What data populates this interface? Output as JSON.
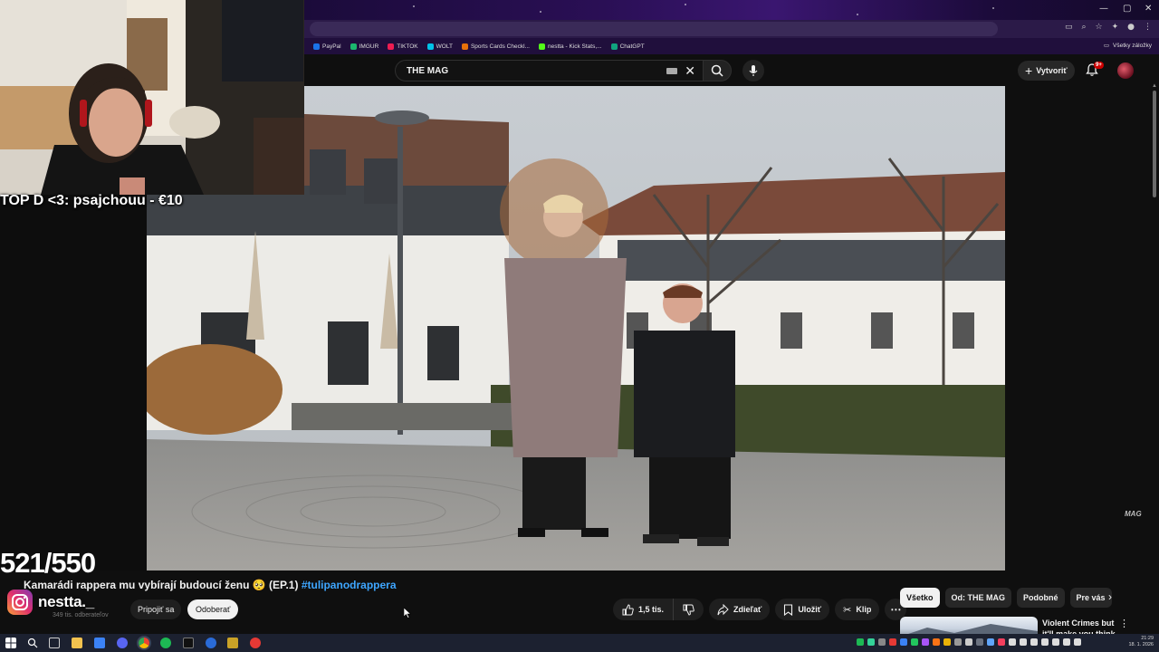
{
  "stream_overlay": {
    "donation_text": "TOP D <3: psajchouu - €10",
    "counter": "521/550",
    "instagram_handle": "nestta._"
  },
  "browser": {
    "bookmarks": [
      {
        "label": "PayPal",
        "color": "#1a73e8"
      },
      {
        "label": "IMGUR",
        "color": "#1bb76e"
      },
      {
        "label": "TIKTOK",
        "color": "#ee1d52"
      },
      {
        "label": "WOLT",
        "color": "#00c2e8"
      },
      {
        "label": "Sports Cards Checkl...",
        "color": "#e8710a"
      },
      {
        "label": "nestta - Kick Stats,...",
        "color": "#53fc18"
      },
      {
        "label": "ChatGPT",
        "color": "#10a37f"
      }
    ],
    "bookmarks_right": "Všetky záložky"
  },
  "youtube": {
    "search": {
      "value": "THE MAG"
    },
    "create_label": "Vytvoriť",
    "notification_badge": "9+",
    "watermark": "MAG",
    "video": {
      "title": "Kamarádi rappera mu vybírají budoucí ženu 🥺 (EP.1)",
      "hashtag": "#tulipanodrappera",
      "subscribers": "349 tis. odberateľov",
      "join_label": "Pripojiť sa",
      "unsubscribe_label": "Odoberať"
    },
    "actions": {
      "likes": "1,5 tis.",
      "share": "Zdieľať",
      "save": "Uložiť",
      "clip": "Klip"
    },
    "chips": [
      "Všetko",
      "Od: THE MAG",
      "Podobné",
      "Pre vás"
    ],
    "recommendation": {
      "title": "Violent Crimes but it'll make you think"
    }
  },
  "taskbar": {
    "time": "21:29",
    "date": "18. 1. 2026"
  },
  "colors": {
    "bg": "#0f0f0f",
    "accent_link": "#3ea6ff",
    "brand_red": "#cc0000"
  }
}
